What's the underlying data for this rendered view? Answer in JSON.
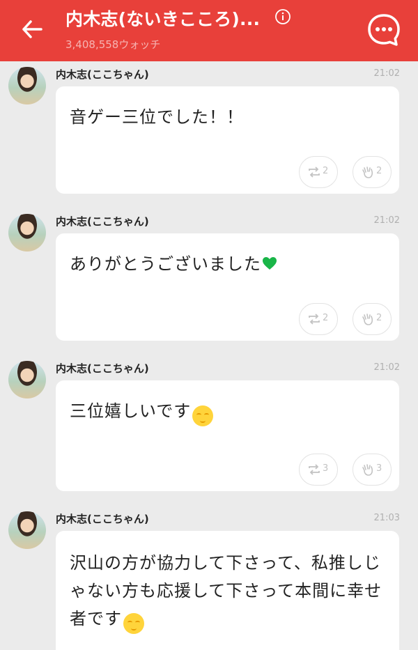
{
  "header": {
    "title": "内木志(ないきこころ)...",
    "watch_count": "3,408,558ウォッチ",
    "bg_color": "#e8403a"
  },
  "posts": [
    {
      "author": "内木志(ここちゃん)",
      "time": "21:02",
      "text": "音ゲー三位でした！！",
      "decoration": "none",
      "retalk_count": "2",
      "clap_count": "2"
    },
    {
      "author": "内木志(ここちゃん)",
      "time": "21:02",
      "text": "ありがとうございました",
      "decoration": "green-heart",
      "retalk_count": "2",
      "clap_count": "2"
    },
    {
      "author": "内木志(ここちゃん)",
      "time": "21:02",
      "text": "三位嬉しいです",
      "decoration": "smile-emoji",
      "retalk_count": "3",
      "clap_count": "3"
    },
    {
      "author": "内木志(ここちゃん)",
      "time": "21:03",
      "text": "沢山の方が協力して下さって、私推しじゃない方も応援して下さって本間に幸せ者です",
      "decoration": "smile-emoji",
      "retalk_count": "",
      "clap_count": ""
    }
  ]
}
